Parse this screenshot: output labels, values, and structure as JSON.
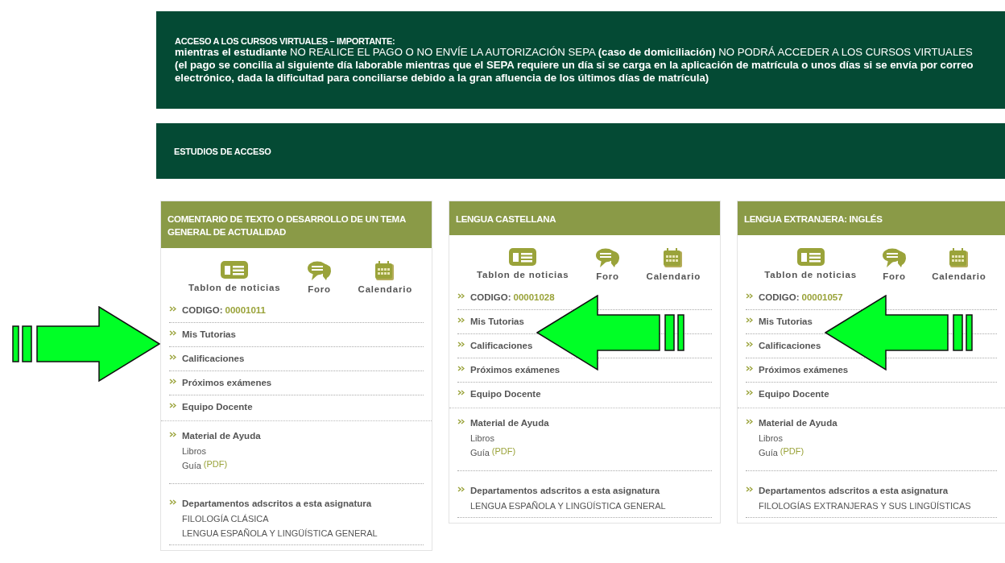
{
  "notice": {
    "heading": "ACCESO A LOS CURSOS VIRTUALES – IMPORTANTE:",
    "body": "**mientras el estudiante** NO REALICE EL PAGO O NO ENVÍE LA AUTORIZACIÓN SEPA **(caso de domiciliación)** NO PODRÁ ACCEDER A LOS CURSOS VIRTUALES **(el pago se concilia al siguiente día laborable mientras que el SEPA requiere un día si se carga en la aplicación de matrícula o unos días si se envía por correo electrónico, dada la dificultad para conciliarse debido a la gran afluencia de los últimos días de matrícula)**"
  },
  "section": {
    "title": "ESTUDIOS DE ACCESO"
  },
  "courses": [
    {
      "title": "COMENTARIO DE TEXTO O DESARROLLO DE UN TEMA GENERAL DE ACTUALIDAD",
      "arrow": {
        "kind": "right"
      },
      "tools": [
        {
          "kind": "board",
          "label": "Tablon de noticias"
        },
        {
          "kind": "forum",
          "label": "Foro"
        },
        {
          "kind": "calendar",
          "label": "Calendario"
        }
      ],
      "code_label": "CODIGO:",
      "code": "00001011",
      "links": [
        "Mis Tutorias",
        "Calificaciones",
        "Próximos exámenes",
        "Equipo Docente"
      ],
      "help": {
        "title": "Material de Ayuda",
        "books": "Libros",
        "guide": "Guía",
        "guide_format": "(PDF)"
      },
      "departments": {
        "title": "Departamentos adscritos a esta asignatura",
        "names": [
          "FILOLOGÍA CLÁSICA",
          "LENGUA ESPAÑOLA Y LINGÜÍSTICA GENERAL"
        ]
      }
    },
    {
      "title": "LENGUA CASTELLANA",
      "arrow": {
        "kind": "left"
      },
      "tools": [
        {
          "kind": "board",
          "label": "Tablon de noticias"
        },
        {
          "kind": "forum",
          "label": "Foro"
        },
        {
          "kind": "calendar",
          "label": "Calendario"
        }
      ],
      "code_label": "CODIGO:",
      "code": "00001028",
      "links": [
        "Mis Tutorias",
        "Calificaciones",
        "Próximos exámenes",
        "Equipo Docente"
      ],
      "help": {
        "title": "Material de Ayuda",
        "books": "Libros",
        "guide": "Guía",
        "guide_format": "(PDF)"
      },
      "departments": {
        "title": "Departamentos adscritos a esta asignatura",
        "names": [
          "LENGUA ESPAÑOLA Y LINGÜÍSTICA GENERAL"
        ]
      }
    },
    {
      "title": "LENGUA EXTRANJERA: INGLÉS",
      "arrow": {
        "kind": "left"
      },
      "tools": [
        {
          "kind": "board",
          "label": "Tablon de noticias"
        },
        {
          "kind": "forum",
          "label": "Foro"
        },
        {
          "kind": "calendar",
          "label": "Calendario"
        }
      ],
      "code_label": "CODIGO:",
      "code": "00001057",
      "links": [
        "Mis Tutorias",
        "Calificaciones",
        "Próximos exámenes",
        "Equipo Docente"
      ],
      "help": {
        "title": "Material de Ayuda",
        "books": "Libros",
        "guide": "Guía",
        "guide_format": "(PDF)"
      },
      "departments": {
        "title": "Departamentos adscritos a esta asignatura",
        "names": [
          "FILOLOGÍAS EXTRANJERAS Y SUS LINGÜÍSTICAS"
        ]
      }
    }
  ]
}
